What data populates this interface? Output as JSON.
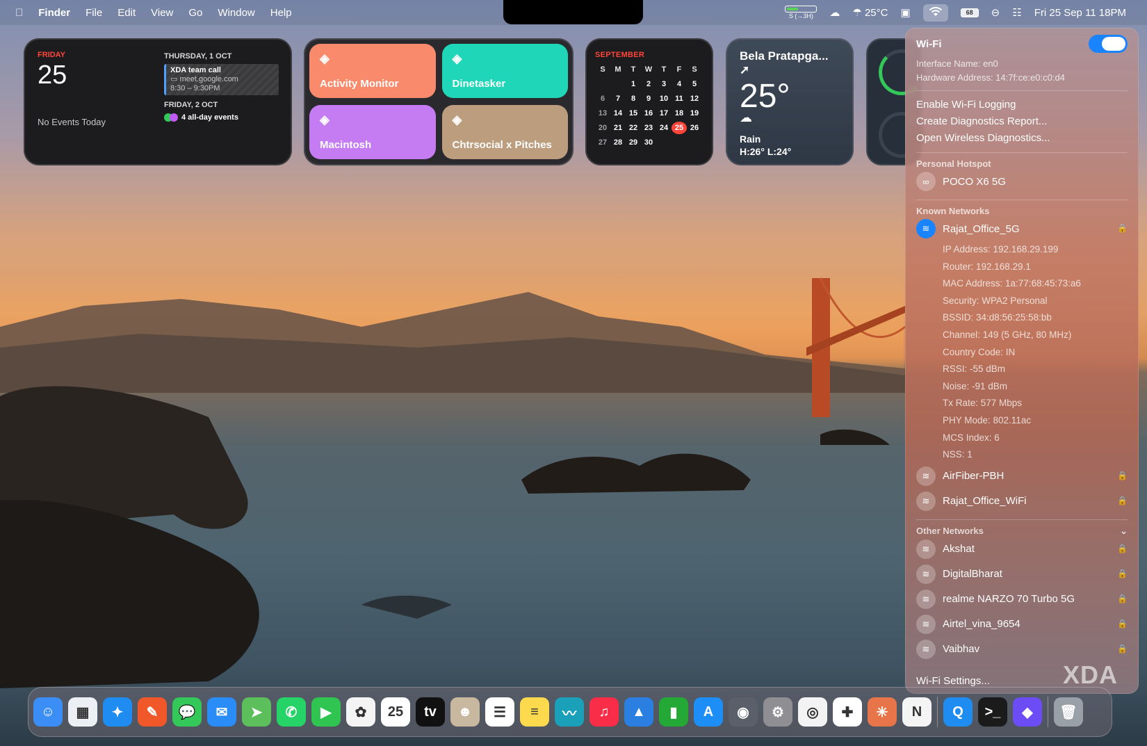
{
  "menubar": {
    "items": [
      "Finder",
      "File",
      "Edit",
      "View",
      "Go",
      "Window",
      "Help"
    ],
    "battery_status": "S (→3H)",
    "weather": "25°C",
    "battery_pct": "68",
    "clock": "Fri 25 Sep  11 18PM"
  },
  "widget_calendar": {
    "day_name": "FRIDAY",
    "day_num": "25",
    "no_events": "No Events Today",
    "next_header": "THURSDAY, 1 OCT",
    "event_title": "XDA team call",
    "event_link": "meet.google.com",
    "event_time": "8:30 – 9:30PM",
    "second_header": "FRIDAY, 2 OCT",
    "all_day": "4 all-day events"
  },
  "shortcuts": [
    {
      "label": "Activity Monitor",
      "color": "#f98a6b"
    },
    {
      "label": "Dinetasker",
      "color": "#1fd6b9"
    },
    {
      "label": "Macintosh",
      "color": "#c57cf2"
    },
    {
      "label": "Chtrsocial x Pitches",
      "color": "#bc9d7e"
    }
  ],
  "month_widget": {
    "month": "SEPTEMBER",
    "weekdays": [
      "S",
      "M",
      "T",
      "W",
      "T",
      "F",
      "S"
    ],
    "days": [
      [
        "",
        "",
        "1",
        "2",
        "3",
        "4",
        "5"
      ],
      [
        "6",
        "7",
        "8",
        "9",
        "10",
        "11",
        "12"
      ],
      [
        "13",
        "14",
        "15",
        "16",
        "17",
        "18",
        "19"
      ],
      [
        "20",
        "21",
        "22",
        "23",
        "24",
        "25",
        "26"
      ],
      [
        "27",
        "28",
        "29",
        "30",
        "",
        "",
        ""
      ]
    ],
    "today": "25"
  },
  "weather_widget": {
    "location": "Bela Pratapga...",
    "temp": "25°",
    "condition": "Rain",
    "hilo": "H:26° L:24°"
  },
  "wifi_panel": {
    "title": "Wi-Fi",
    "interface": "Interface Name: en0",
    "hardware": "Hardware Address: 14:7f:ce:e0:c0:d4",
    "menu": [
      "Enable Wi-Fi Logging",
      "Create Diagnostics Report...",
      "Open Wireless Diagnostics..."
    ],
    "hotspot_header": "Personal Hotspot",
    "hotspot": "POCO X6 5G",
    "known_header": "Known Networks",
    "connected": "Rajat_Office_5G",
    "details": [
      "IP Address: 192.168.29.199",
      "Router: 192.168.29.1",
      "MAC Address: 1a:77:68:45:73:a6",
      "Security: WPA2 Personal",
      "BSSID: 34:d8:56:25:58:bb",
      "Channel: 149 (5 GHz, 80 MHz)",
      "Country Code: IN",
      "RSSI: -55 dBm",
      "Noise: -91 dBm",
      "Tx Rate: 577 Mbps",
      "PHY Mode: 802.11ac",
      "MCS Index: 6",
      "NSS: 1"
    ],
    "known": [
      "AirFiber-PBH",
      "Rajat_Office_WiFi"
    ],
    "other_header": "Other Networks",
    "other": [
      "Akshat",
      "DigitalBharat",
      "realme NARZO 70 Turbo 5G",
      "Airtel_vina_9654",
      "Vaibhav"
    ],
    "settings": "Wi-Fi Settings...",
    "watermark": "XDA"
  },
  "dock": [
    {
      "name": "finder",
      "glyph": "☺",
      "color": "#3a8ef5"
    },
    {
      "name": "launchpad",
      "glyph": "▦",
      "color": "#eceff4"
    },
    {
      "name": "safari",
      "glyph": "✦",
      "color": "#1e8cf0"
    },
    {
      "name": "pages",
      "glyph": "✎",
      "color": "#f0582a"
    },
    {
      "name": "messages",
      "glyph": "💬",
      "color": "#34c759"
    },
    {
      "name": "mail",
      "glyph": "✉",
      "color": "#2a8cf7"
    },
    {
      "name": "maps",
      "glyph": "➤",
      "color": "#5cbf5c"
    },
    {
      "name": "whatsapp",
      "glyph": "✆",
      "color": "#25d366"
    },
    {
      "name": "facetime",
      "glyph": "▶",
      "color": "#30c551"
    },
    {
      "name": "photos",
      "glyph": "✿",
      "color": "#f4f4f4"
    },
    {
      "name": "calendar",
      "glyph": "25",
      "color": "#ffffff"
    },
    {
      "name": "apple-tv",
      "glyph": "tv",
      "color": "#111111"
    },
    {
      "name": "contacts",
      "glyph": "☻",
      "color": "#c8b8a0"
    },
    {
      "name": "reminders",
      "glyph": "☰",
      "color": "#ffffff"
    },
    {
      "name": "notes",
      "glyph": "≡",
      "color": "#fdd94e"
    },
    {
      "name": "freeform",
      "glyph": "〰",
      "color": "#1aa0b8"
    },
    {
      "name": "music",
      "glyph": "♫",
      "color": "#fa2d48"
    },
    {
      "name": "keynote",
      "glyph": "▲",
      "color": "#2a7fe0"
    },
    {
      "name": "numbers",
      "glyph": "▮",
      "color": "#24a936"
    },
    {
      "name": "app-store",
      "glyph": "A",
      "color": "#1c8ef5"
    },
    {
      "name": "disk-utility",
      "glyph": "◉",
      "color": "#5a5f6a"
    },
    {
      "name": "system-settings",
      "glyph": "⚙",
      "color": "#8e8e93"
    },
    {
      "name": "chrome",
      "glyph": "◎",
      "color": "#f3f3f3"
    },
    {
      "name": "slack",
      "glyph": "✚",
      "color": "#ffffff"
    },
    {
      "name": "claude",
      "glyph": "✳",
      "color": "#e8744a"
    },
    {
      "name": "notion",
      "glyph": "N",
      "color": "#f4f4f4"
    },
    {
      "name": "quicktime",
      "glyph": "Q",
      "color": "#1e8cf0"
    },
    {
      "name": "terminal",
      "glyph": ">_",
      "color": "#1b1b1b"
    },
    {
      "name": "shortcuts",
      "glyph": "◆",
      "color": "#6b4cf5"
    },
    {
      "name": "trash",
      "glyph": "🗑",
      "color": "#9aa0a8"
    }
  ]
}
